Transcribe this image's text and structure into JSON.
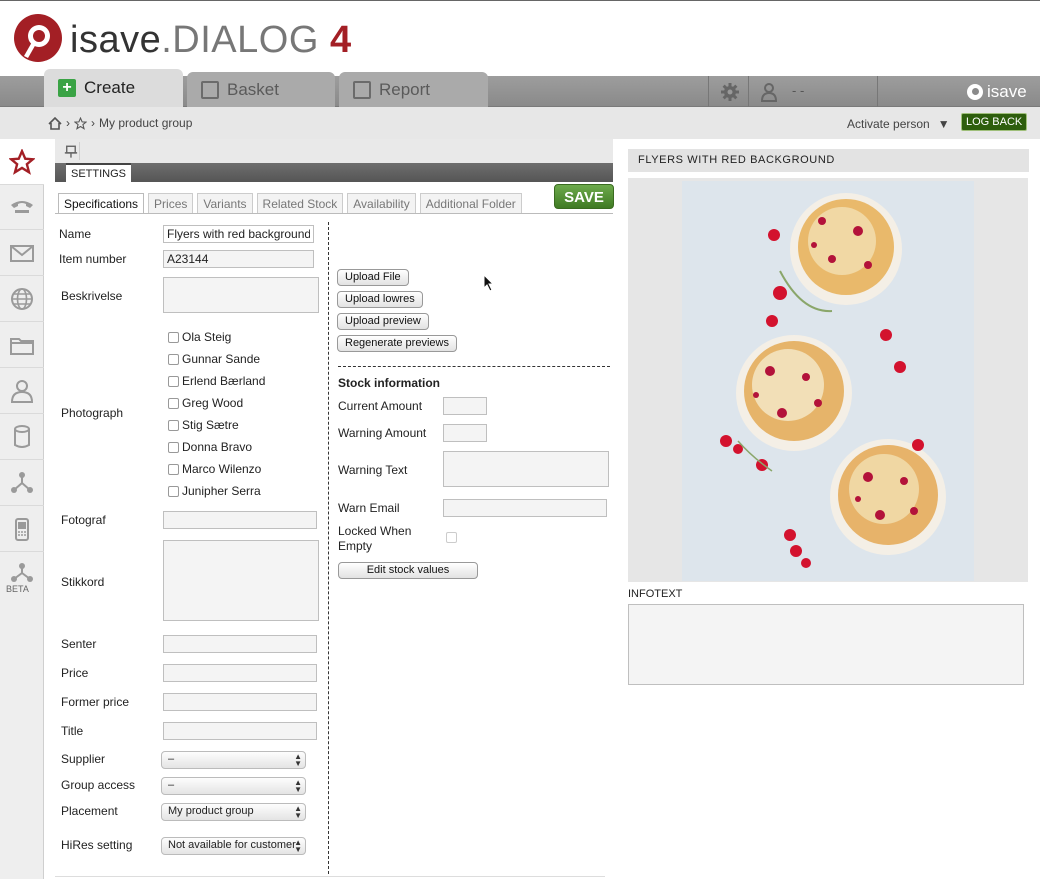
{
  "app": {
    "brand": "isave",
    "product": "DIALOG",
    "version": "4",
    "brand_small": "isave"
  },
  "tabs": [
    {
      "label": "Create",
      "icon": "plus-icon",
      "active": true
    },
    {
      "label": "Basket",
      "icon": "basket-icon",
      "active": false
    },
    {
      "label": "Report",
      "icon": "report-icon",
      "active": false
    }
  ],
  "header": {
    "user_name": "- -"
  },
  "breadcrumb": {
    "current": "My product group",
    "separator": "›"
  },
  "topright": {
    "activate_label": "Activate person",
    "activate_arrow": "▼",
    "logback_label": "LOG BACK"
  },
  "sidebar": {
    "items": [
      "star-icon",
      "phone-icon",
      "mail-icon",
      "globe-icon",
      "folder-icon",
      "person-icon",
      "database-icon",
      "network-icon",
      "mobile-icon",
      "workflow-icon"
    ],
    "beta_label": "BETA"
  },
  "settings_label": "SETTINGS",
  "save_label": "SAVE",
  "subtabs": [
    "Specifications",
    "Prices",
    "Variants",
    "Related Stock",
    "Availability",
    "Additional Folder"
  ],
  "form": {
    "name_label": "Name",
    "name_value": "Flyers with red background",
    "item_number_label": "Item number",
    "item_number_value": "A23144",
    "beskrivelse_label": "Beskrivelse",
    "photograph_label": "Photograph",
    "photographers": [
      "Ola Steig",
      "Gunnar Sande",
      "Erlend Bærland",
      "Greg Wood",
      "Stig Sætre",
      "Donna Bravo",
      "Marco Wilenzo",
      "Junipher Serra"
    ],
    "fotograf_label": "Fotograf",
    "stikkord_label": "Stikkord",
    "senter_label": "Senter",
    "price_label": "Price",
    "former_price_label": "Former price",
    "title_label": "Title",
    "supplier_label": "Supplier",
    "supplier_value": "–",
    "group_access_label": "Group access",
    "group_access_value": "–",
    "placement_label": "Placement",
    "placement_value": "My product group",
    "hires_label": "HiRes setting",
    "hires_value": "Not available for customer"
  },
  "upload_buttons": [
    "Upload File",
    "Upload lowres",
    "Upload preview",
    "Regenerate previews"
  ],
  "stock": {
    "title": "Stock information",
    "current_amount_label": "Current Amount",
    "warning_amount_label": "Warning Amount",
    "warning_text_label": "Warning Text",
    "warn_email_label": "Warn Email",
    "locked_label_1": "Locked When",
    "locked_label_2": "Empty",
    "edit_button": "Edit stock values"
  },
  "preview": {
    "heading": "FLYERS WITH RED BACKGROUND",
    "infotext_label": "INFOTEXT"
  },
  "colors": {
    "brand_red": "#a31f25",
    "save_green": "#4e8a2f",
    "logback_green": "#2e5e0d",
    "create_green": "#3aa345"
  }
}
